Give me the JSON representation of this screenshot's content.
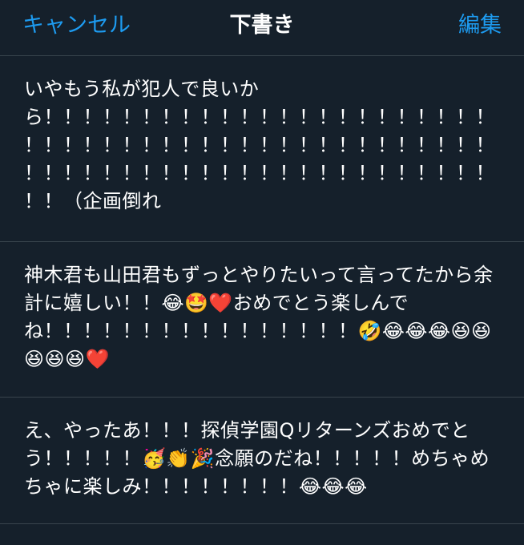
{
  "header": {
    "cancel_label": "キャンセル",
    "title": "下書き",
    "edit_label": "編集"
  },
  "drafts": [
    {
      "text": "いやもう私が犯人で良いから！！！！！！！！！！！！！！！！！！！！！！！！！！！！！！！！！！！！！！！！！！！！！！！！！！！！！！！！！！！！！！！！！！！！！！！！！（企画倒れ"
    },
    {
      "text": "神木君も山田君もずっとやりたいって言ってたから余計に嬉しい！！😂🤩❤️おめでとう楽しんでね！！！！！！！！！！！！！！！！🤣😂😂😂😆😆😆😆😆❤️"
    },
    {
      "text": "え、やったあ！！！探偵学園Qリターンズおめでとう！！！！！🥳👏🎉念願のだね！！！！！めちゃめちゃに楽しみ！！！！！！！！😂😂😂"
    }
  ]
}
